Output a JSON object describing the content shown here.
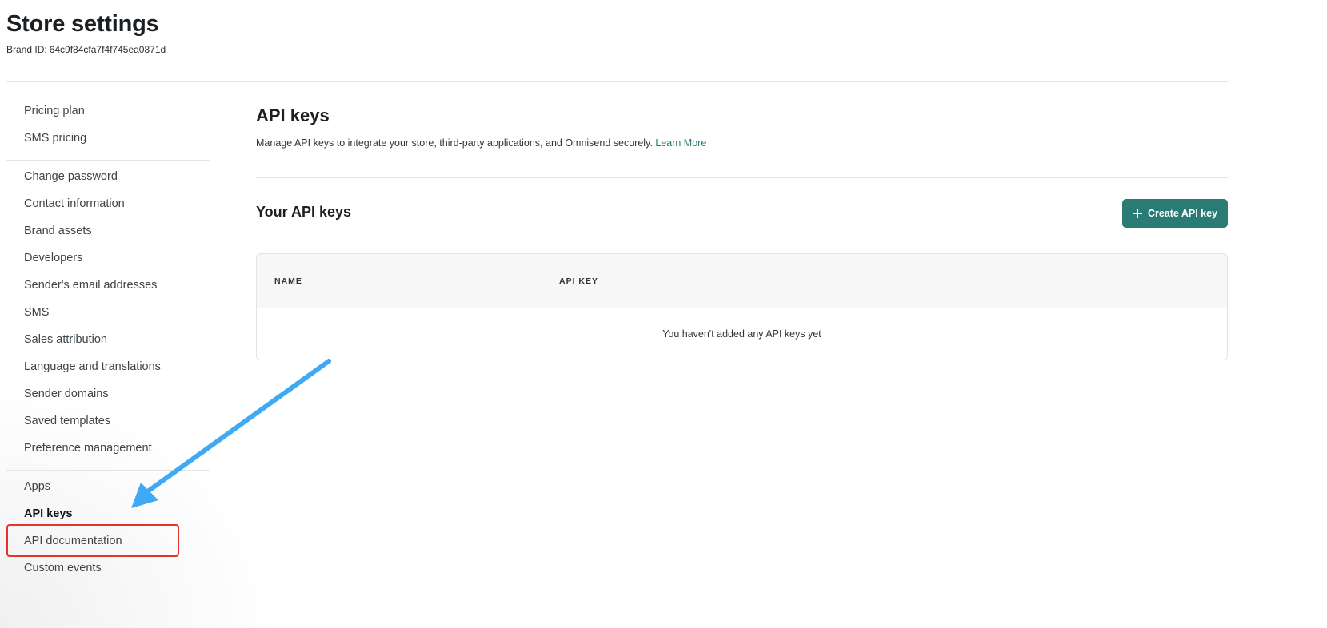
{
  "header": {
    "title": "Store settings",
    "brand_label": "Brand ID:",
    "brand_id": "64c9f84cfa7f4f745ea0871d"
  },
  "sidebar": {
    "groups": [
      {
        "items": [
          "Pricing plan",
          "SMS pricing"
        ]
      },
      {
        "items": [
          "Change password",
          "Contact information",
          "Brand assets",
          "Developers",
          "Sender's email addresses",
          "SMS",
          "Sales attribution",
          "Language and translations",
          "Sender domains",
          "Saved templates",
          "Preference management"
        ]
      },
      {
        "items": [
          "Apps",
          "API keys",
          "API documentation",
          "Custom events"
        ]
      }
    ],
    "active_item": "API keys"
  },
  "main": {
    "title": "API keys",
    "description": "Manage API keys to integrate your store, third-party applications, and Omnisend securely.",
    "learn_more": "Learn More",
    "keys_title": "Your API keys",
    "create_button": "Create API key",
    "table": {
      "columns": [
        "NAME",
        "API KEY"
      ],
      "empty_message": "You haven't added any API keys yet"
    }
  },
  "annotation": {
    "arrow_color": "#3fa9f5",
    "highlight_color": "#e4322f"
  },
  "colors": {
    "accent": "#2a7b73",
    "link": "#1a7a70"
  },
  "icons": {
    "create_button_icon": "plus-icon"
  }
}
